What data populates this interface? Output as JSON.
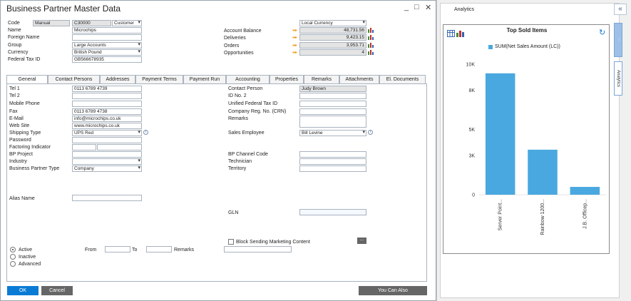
{
  "window": {
    "title": "Business Partner Master Data",
    "minimize": "_",
    "maximize": "□",
    "close": "✕"
  },
  "header": {
    "code_label": "Code",
    "code_series": "Manual",
    "code_value": "C30000",
    "code_type": "Customer",
    "name_label": "Name",
    "name_value": "Microchips",
    "foreign_name_label": "Foreign Name",
    "foreign_name_value": "",
    "group_label": "Group",
    "group_value": "Large Accounts",
    "currency_label": "Currency",
    "currency_value": "British Pound",
    "tax_id_label": "Federal Tax ID",
    "tax_id_value": "GB566678935",
    "currency_mode": "Local Currency",
    "account_balance_label": "Account Balance",
    "account_balance_value": "48,731.56",
    "deliveries_label": "Deliveries",
    "deliveries_value": "9,423.15",
    "orders_label": "Orders",
    "orders_value": "3,953.71",
    "opportunities_label": "Opportunities",
    "opportunities_value": "4"
  },
  "tabs": [
    "General",
    "Contact Persons",
    "Addresses",
    "Payment Terms",
    "Payment Run",
    "Accounting",
    "Properties",
    "Remarks",
    "Attachments",
    "El. Documents"
  ],
  "general": {
    "tel1_label": "Tel 1",
    "tel1_value": "0113 6789 4739",
    "tel2_label": "Tel 2",
    "tel2_value": "",
    "mobile_label": "Mobile Phone",
    "mobile_value": "",
    "fax_label": "Fax",
    "fax_value": "0113 6789 4738",
    "email_label": "E-Mail",
    "email_value": "info@microchips.co.uk",
    "website_label": "Web Site",
    "website_value": "www.microchips.co.uk",
    "shipping_label": "Shipping Type",
    "shipping_value": "UPS Red",
    "password_label": "Password",
    "factoring_label": "Factoring Indicator",
    "bp_project_label": "BP Project",
    "industry_label": "Industry",
    "bp_type_label": "Business Partner Type",
    "bp_type_value": "Company",
    "alias_label": "Alias Name",
    "contact_person_label": "Contact Person",
    "contact_person_value": "Judy Brown",
    "id_no2_label": "ID No. 2",
    "unified_tax_label": "Unified Federal Tax ID",
    "company_reg_label": "Company Reg. No. (CRN)",
    "remarks_label": "Remarks",
    "sales_employee_label": "Sales Employee",
    "sales_employee_value": "Bill Levine",
    "bp_channel_label": "BP Channel Code",
    "technician_label": "Technician",
    "territory_label": "Territory",
    "gln_label": "GLN",
    "block_label": "Block Sending Marketing Content",
    "more_btn": "...",
    "active_label": "Active",
    "inactive_label": "Inactive",
    "advanced_label": "Advanced",
    "from_label": "From",
    "to_label": "To",
    "remarks2_label": "Remarks"
  },
  "footer": {
    "ok": "OK",
    "cancel": "Cancel",
    "you_can_also": "You Can Also"
  },
  "side_panel": {
    "tab_label": "Analytics",
    "collapse": "«",
    "vtab1": "...",
    "vtab2": "Analytics",
    "card_title": "Top Sold Items",
    "refresh_icon": "↻"
  },
  "chart_data": {
    "type": "bar",
    "title": "Top Sold Items",
    "series": [
      {
        "name": "SUM(Net Sales Amount (LC))",
        "values": [
          9300,
          3450,
          600
        ]
      }
    ],
    "categories": [
      "Server Point...",
      "Rainbow 1200...",
      "J.B. Officep..."
    ],
    "yticks": [
      "10K",
      "8K",
      "5K",
      "3K",
      "0"
    ],
    "ylim": [
      0,
      10000
    ],
    "color": "#4aa8e0"
  }
}
